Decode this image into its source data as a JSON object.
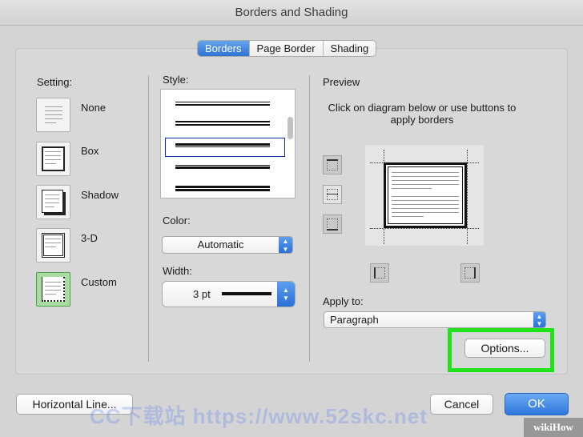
{
  "window": {
    "title": "Borders and Shading"
  },
  "tabs": [
    {
      "label": "Borders",
      "active": true
    },
    {
      "label": "Page Border",
      "active": false
    },
    {
      "label": "Shading",
      "active": false
    }
  ],
  "setting": {
    "heading": "Setting:",
    "options": [
      {
        "label": "None",
        "icon": "border-none-icon",
        "selected": false
      },
      {
        "label": "Box",
        "icon": "border-box-icon",
        "selected": false
      },
      {
        "label": "Shadow",
        "icon": "border-shadow-icon",
        "selected": false
      },
      {
        "label": "3-D",
        "icon": "border-3d-icon",
        "selected": false
      },
      {
        "label": "Custom",
        "icon": "border-custom-icon",
        "selected": true
      }
    ]
  },
  "style": {
    "heading": "Style:",
    "selected_index": 2
  },
  "color": {
    "heading": "Color:",
    "value": "Automatic"
  },
  "width": {
    "heading": "Width:",
    "value": "3 pt"
  },
  "preview": {
    "heading": "Preview",
    "instructions": "Click on diagram below or use buttons to apply borders"
  },
  "apply_to": {
    "heading": "Apply to:",
    "value": "Paragraph"
  },
  "buttons": {
    "options": "Options...",
    "horizontal_line": "Horizontal Line...",
    "cancel": "Cancel",
    "ok": "OK"
  },
  "colors": {
    "accent": "#2f73d6",
    "highlight": "#21e21a"
  },
  "watermark": "CC下载站 https://www.52skc.net",
  "badge": "wikiHow"
}
